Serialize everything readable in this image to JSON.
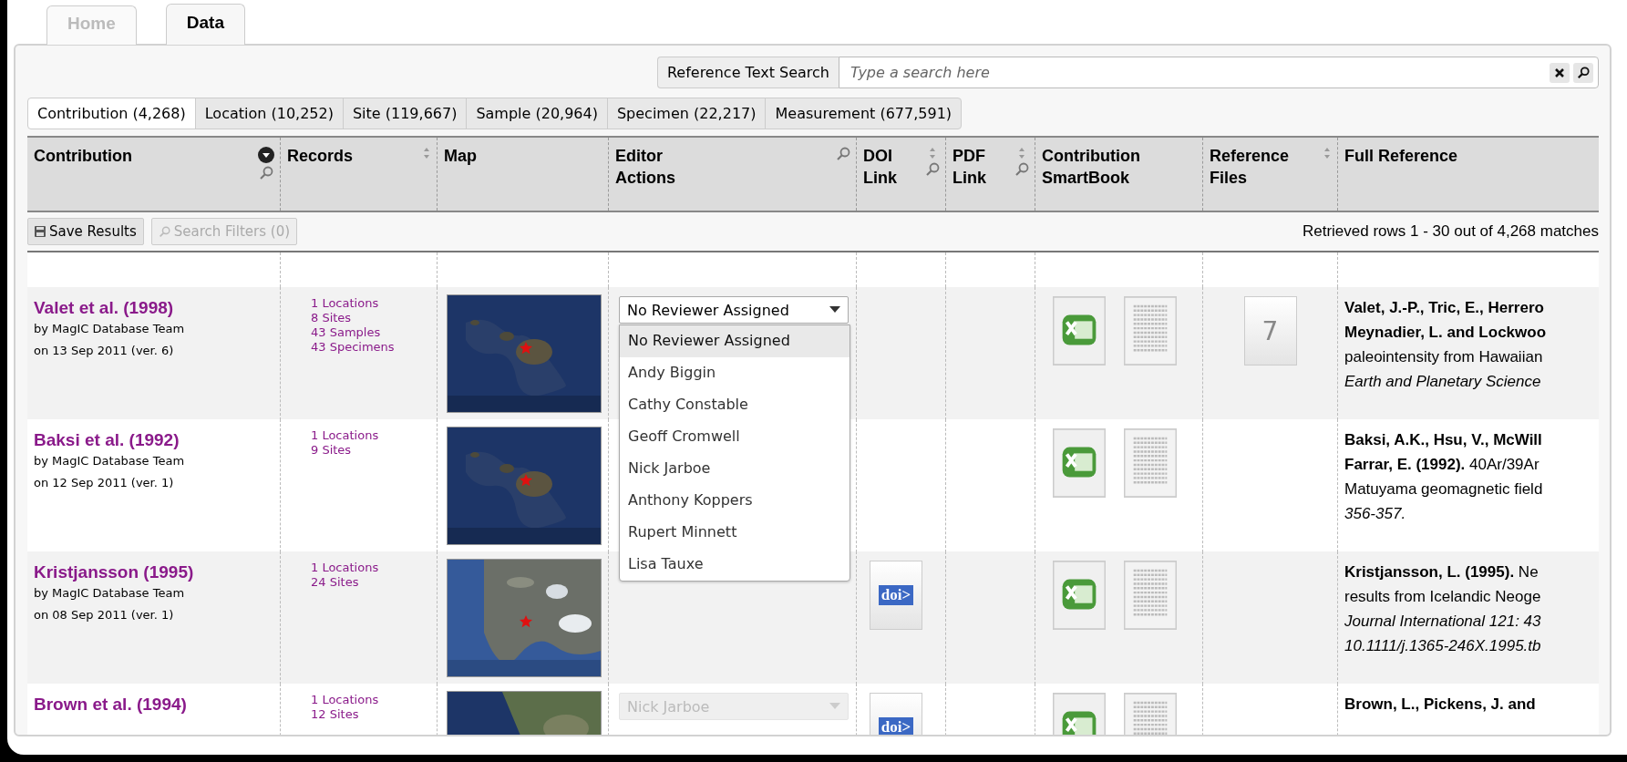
{
  "top_tabs": [
    {
      "label": "Home",
      "selected": false
    },
    {
      "label": "Data",
      "selected": true
    }
  ],
  "search": {
    "label": "Reference Text Search",
    "placeholder": "Type a search here"
  },
  "entity_tabs": [
    {
      "label": "Contribution (4,268)",
      "selected": true
    },
    {
      "label": "Location (10,252)",
      "selected": false
    },
    {
      "label": "Site (119,667)",
      "selected": false
    },
    {
      "label": "Sample (20,964)",
      "selected": false
    },
    {
      "label": "Specimen (22,217)",
      "selected": false
    },
    {
      "label": "Measurement (677,591)",
      "selected": false
    }
  ],
  "table": {
    "columns": [
      {
        "label": "Contribution",
        "sortable": false,
        "sorted": true,
        "filterable": true
      },
      {
        "label": "Records",
        "sortable": true,
        "sorted": false,
        "filterable": false
      },
      {
        "label": "Map",
        "sortable": false,
        "sorted": false,
        "filterable": false
      },
      {
        "label": "Editor Actions",
        "sortable": false,
        "sorted": false,
        "filterable": true
      },
      {
        "label": "DOI Link",
        "sortable": true,
        "sorted": false,
        "filterable": true
      },
      {
        "label": "PDF Link",
        "sortable": true,
        "sorted": false,
        "filterable": true
      },
      {
        "label": "Contribution SmartBook",
        "sortable": false,
        "sorted": false,
        "filterable": false
      },
      {
        "label": "Reference Files",
        "sortable": true,
        "sorted": false,
        "filterable": false
      },
      {
        "label": "Full Reference",
        "sortable": false,
        "sorted": false,
        "filterable": false
      }
    ],
    "toolbar": {
      "save": "Save Results",
      "filters": "Search Filters (0)",
      "filters_disabled": true,
      "status": "Retrieved rows 1 - 30 out of 4,268 matches"
    },
    "rows": [
      {
        "title": "Valet et al. (1998)",
        "by": "by MagIC Database Team",
        "date": "on 13 Sep 2011 (ver. 6)",
        "records": [
          "1 Locations",
          "8 Sites",
          "43 Samples",
          "43 Specimens"
        ],
        "map": {
          "kind": "picture"
        },
        "editor": {
          "value": "No Reviewer Assigned",
          "disabled": false,
          "open": true,
          "options": [
            {
              "label": "No Reviewer Assigned",
              "selected": true
            },
            {
              "label": "Andy Biggin",
              "selected": false
            },
            {
              "label": "Cathy Constable",
              "selected": false
            },
            {
              "label": "Geoff Cromwell",
              "selected": false
            },
            {
              "label": "Nick Jarboe",
              "selected": false
            },
            {
              "label": "Anthony Koppers",
              "selected": false
            },
            {
              "label": "Rupert Minnett",
              "selected": false
            },
            {
              "label": "Lisa Tauxe",
              "selected": false
            }
          ]
        },
        "smartbook": true,
        "ref_files": "7",
        "reference": [
          "**Valet, J.-P., Tric, E., Herrero**",
          "**Meynadier, L. and Lockwoo**",
          "paleointensity from Hawaiian",
          "*Earth and Planetary Science*"
        ]
      },
      {
        "title": "Baksi et al. (1992)",
        "by": "by MagIC Database Team",
        "date": "on 12 Sep 2011 (ver. 1)",
        "records": [
          "1 Locations",
          "9 Sites"
        ],
        "map": {
          "kind": "picture"
        },
        "smartbook": true,
        "reference": [
          "**Baksi, A.K., Hsu, V., McWill**",
          "**Farrar, E. (1992).** 40Ar/39Ar",
          "Matuyama geomagnetic field",
          "*356-357.*"
        ]
      },
      {
        "title": "Kristjansson (1995)",
        "by": "by MagIC Database Team",
        "date": "on 08 Sep 2011 (ver. 1)",
        "records": [
          "1 Locations",
          "24 Sites"
        ],
        "map": {
          "kind": "picture"
        },
        "doi": "doi>",
        "smartbook": true,
        "reference": [
          "**Kristjansson, L. (1995).** Ne",
          "results from Icelandic Neoge",
          "*Journal International 121: 43*",
          "*10.1111/j.1365-246X.1995.tb*"
        ]
      },
      {
        "title": "Brown et al. (1994)",
        "records": [
          "1 Locations",
          "12 Sites"
        ],
        "map": {
          "kind": "picture"
        },
        "editor": {
          "value": "Nick Jarboe",
          "disabled": true,
          "open": false
        },
        "doi": "doi>",
        "smartbook": true,
        "reference": [
          "**Brown, L., Pickens, J. and**"
        ]
      }
    ]
  }
}
